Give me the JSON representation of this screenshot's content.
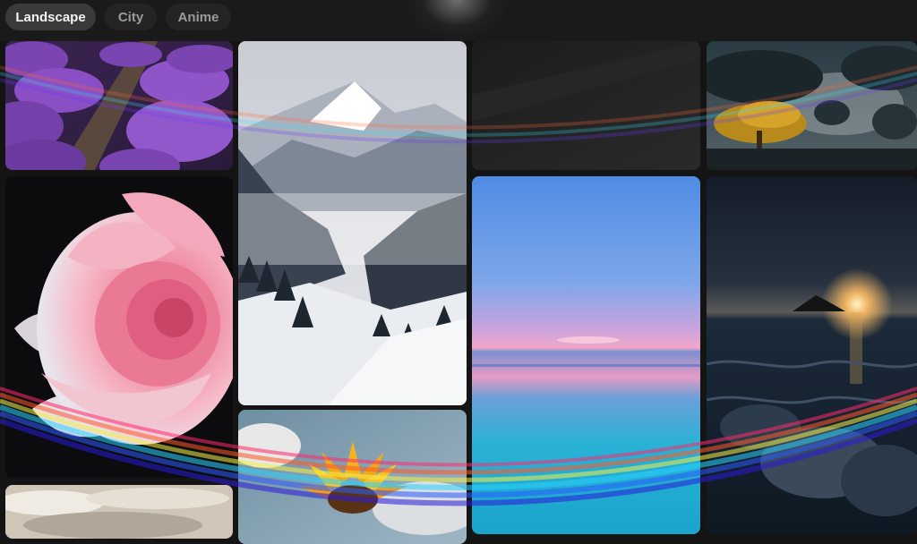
{
  "tabs": [
    {
      "label": "Landscape",
      "active": true
    },
    {
      "label": "City",
      "active": false
    },
    {
      "label": "Anime",
      "active": false
    }
  ],
  "gallery": {
    "tiles": [
      {
        "name": "lavender-field-image",
        "subject": "lavender field"
      },
      {
        "name": "pink-rose-image",
        "subject": "pink rose"
      },
      {
        "name": "cloudy-sky-image",
        "subject": "cloudy sky"
      },
      {
        "name": "snowy-mountains-image",
        "subject": "snowy mountain valley"
      },
      {
        "name": "sunflower-image",
        "subject": "sunflower"
      },
      {
        "name": "dark-landscape-image",
        "subject": "dark landscape"
      },
      {
        "name": "pastel-sea-image",
        "subject": "pastel sunset sea"
      },
      {
        "name": "misty-lake-tree-image",
        "subject": "misty lake with tree"
      },
      {
        "name": "night-ocean-image",
        "subject": "night ocean with island"
      }
    ]
  },
  "colors": {
    "background": "#141414",
    "tab_active_bg": "#3a3a3a",
    "tab_inactive_bg": "#242424"
  }
}
